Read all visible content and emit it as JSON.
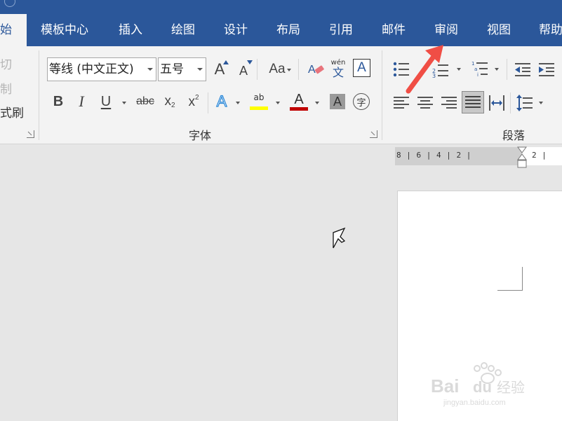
{
  "tabs": {
    "home": "始",
    "template_center": "模板中心",
    "insert": "插入",
    "draw": "绘图",
    "design": "设计",
    "layout": "布局",
    "references": "引用",
    "mailings": "邮件",
    "review": "审阅",
    "view": "视图",
    "help": "帮助"
  },
  "clipboard": {
    "cut": "切",
    "copy": "制",
    "format_painter": "式刷"
  },
  "font_group": {
    "label": "字体",
    "font_name": "等线 (中文正文)",
    "font_size": "五号",
    "grow_font": "A",
    "shrink_font": "A",
    "change_case": "Aa",
    "phonetic_top": "wén",
    "phonetic_bottom": "文",
    "char_border": "A",
    "bold": "B",
    "italic": "I",
    "underline": "U",
    "strikethrough": "abc",
    "subscript": "x",
    "subscript_mark": "2",
    "superscript": "x",
    "superscript_mark": "2",
    "text_effects": "A",
    "highlight": "ab",
    "font_color": "A",
    "char_shading": "A",
    "enclose_char": "字"
  },
  "paragraph_group": {
    "label": "段落"
  },
  "ruler": {
    "left_ticks": "8 | 6 | 4 | 2 |",
    "right_ticks": "2 |"
  },
  "colors": {
    "ribbon_blue": "#2b579a",
    "highlight_yellow": "#ffff00",
    "font_red": "#c00000",
    "arrow_red": "#f04e45"
  }
}
